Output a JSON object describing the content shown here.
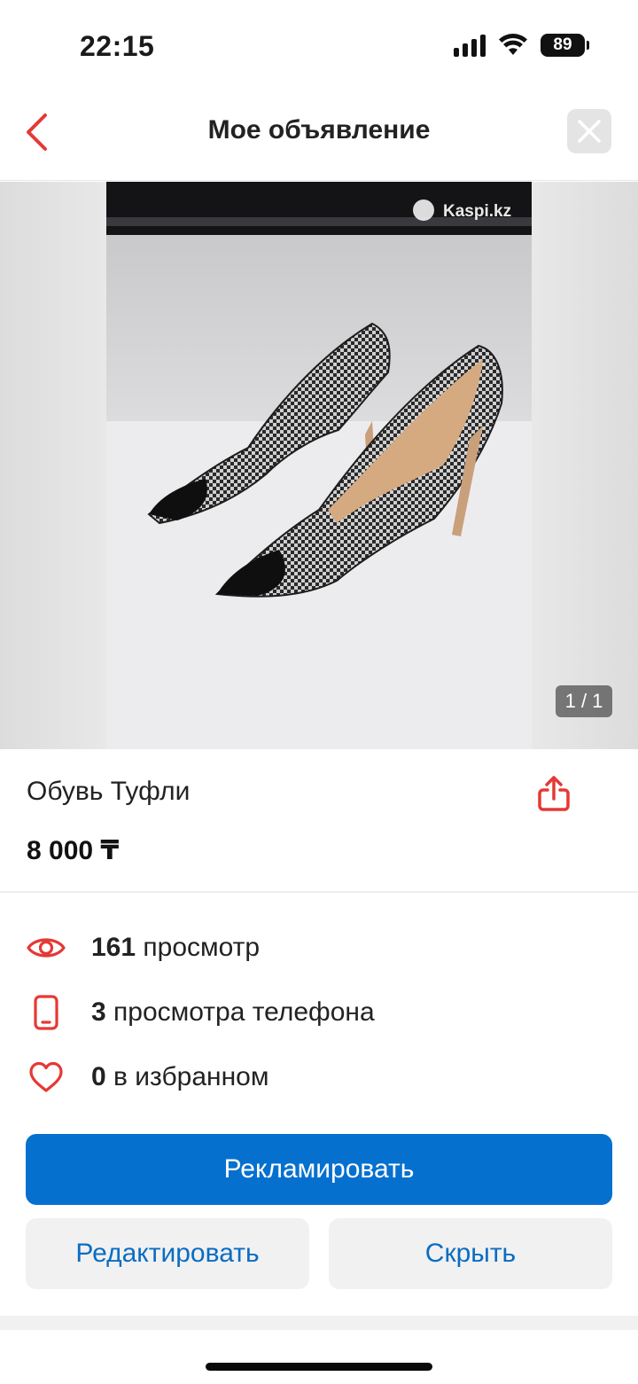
{
  "status_bar": {
    "time": "22:15",
    "battery": "89",
    "icons": [
      "signal-icon",
      "wifi-icon",
      "battery-icon"
    ]
  },
  "header": {
    "title": "Мое объявление",
    "back_icon": "chevron-left-icon",
    "close_icon": "close-icon"
  },
  "gallery": {
    "counter": "1 / 1",
    "watermark": "Kaspi.kz"
  },
  "listing": {
    "title": "Обувь Туфли",
    "price": "8 000 ₸",
    "share_icon": "share-icon"
  },
  "stats": [
    {
      "icon": "eye-icon",
      "count": "161",
      "label": " просмотр"
    },
    {
      "icon": "phone-icon",
      "count": "3",
      "label": " просмотра телефона"
    },
    {
      "icon": "heart-icon",
      "count": "0",
      "label": " в избранном"
    }
  ],
  "actions": {
    "promote_label": "Рекламировать",
    "edit_label": "Редактировать",
    "hide_label": "Скрыть"
  },
  "colors": {
    "accent_red": "#e53935",
    "primary_blue": "#0670cf",
    "link_blue": "#0a6dc2"
  }
}
